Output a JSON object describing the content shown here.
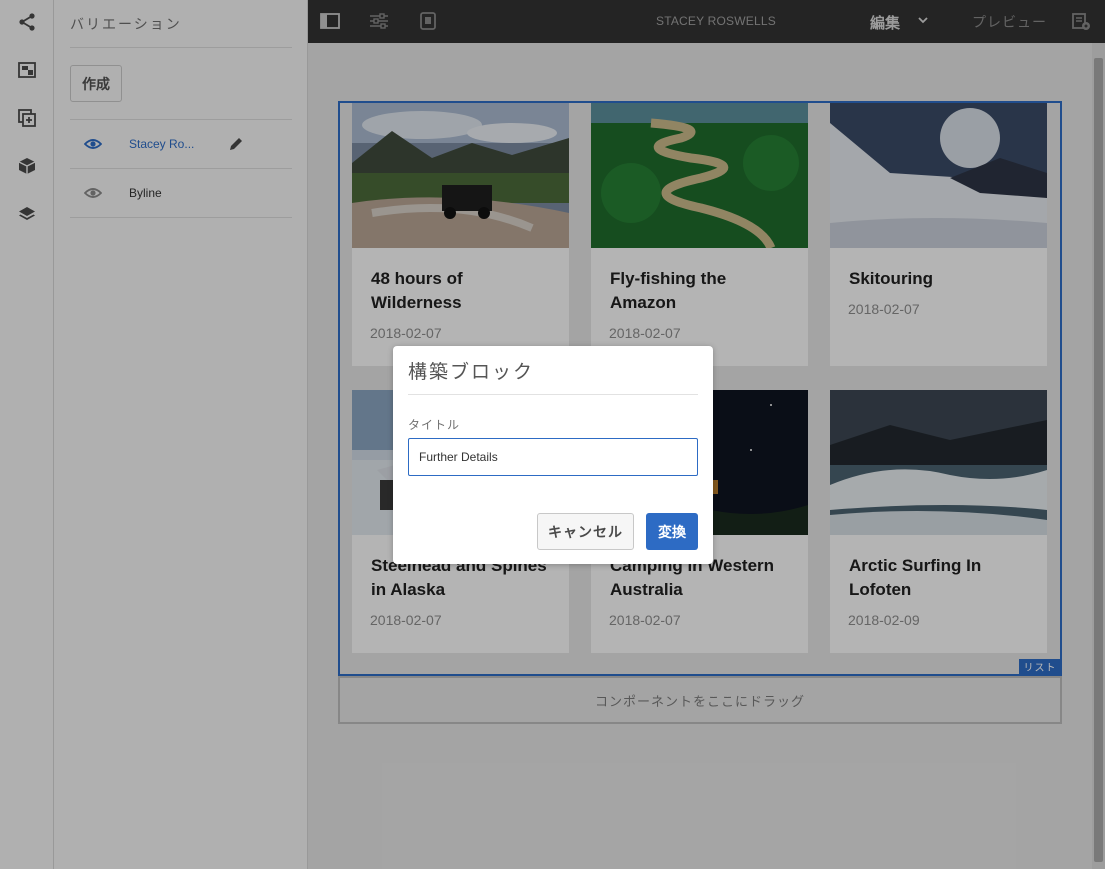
{
  "rail": {
    "icons": [
      "share-icon",
      "variations-icon",
      "add-component-icon",
      "assets-icon",
      "layers-icon"
    ]
  },
  "panel": {
    "title": "バリエーション",
    "create_label": "作成",
    "variations": [
      {
        "label": "Stacey Ro...",
        "active": true
      },
      {
        "label": "Byline",
        "active": false
      }
    ]
  },
  "toolbar": {
    "title": "STACEY ROSWELLS",
    "mode_label": "編集",
    "preview_label": "プレビュー"
  },
  "list": {
    "badge": "リスト",
    "cards": [
      {
        "title": "48 hours of Wilderness",
        "date": "2018-02-07"
      },
      {
        "title": "Fly-fishing the Amazon",
        "date": "2018-02-07"
      },
      {
        "title": "Skitouring",
        "date": "2018-02-07"
      },
      {
        "title": "Steelhead and Spines in Alaska",
        "date": "2018-02-07"
      },
      {
        "title": "Camping in Western Australia",
        "date": "2018-02-07"
      },
      {
        "title": "Arctic Surfing In Lofoten",
        "date": "2018-02-09"
      }
    ]
  },
  "dropzone": {
    "label": "コンポーネントをここにドラッグ"
  },
  "dialog": {
    "title": "構築ブロック",
    "field_label": "タイトル",
    "field_value": "Further Details",
    "cancel_label": "キャンセル",
    "convert_label": "変換"
  },
  "colors": {
    "accent": "#2d6bc4",
    "toolbar": "#323232"
  }
}
